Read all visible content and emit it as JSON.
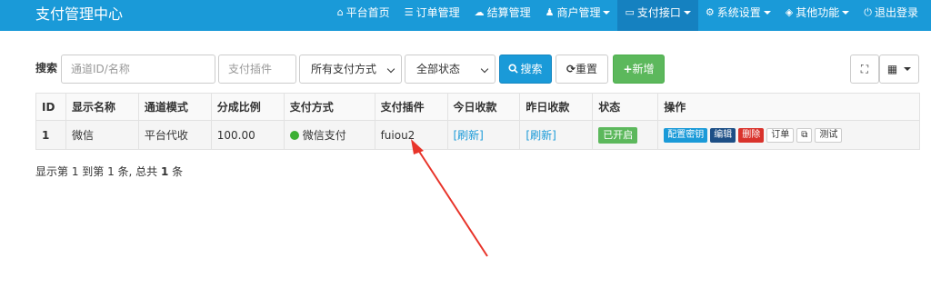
{
  "brand": "支付管理中心",
  "nav": [
    {
      "icon": "home-icon",
      "glyph": "⌂",
      "label": "平台首页"
    },
    {
      "icon": "list-icon",
      "glyph": "☰",
      "label": "订单管理"
    },
    {
      "icon": "cloud-icon",
      "glyph": "☁",
      "label": "结算管理"
    },
    {
      "icon": "user-icon",
      "glyph": "♟",
      "label": "商户管理"
    },
    {
      "icon": "card-icon",
      "glyph": "▭",
      "label": "支付接口"
    },
    {
      "icon": "gear-icon",
      "glyph": "⚙",
      "label": "系统设置"
    },
    {
      "icon": "cube-icon",
      "glyph": "◈",
      "label": "其他功能"
    },
    {
      "icon": "power-icon",
      "glyph": "⏻",
      "label": "退出登录"
    }
  ],
  "toolbar": {
    "search_label": "搜索",
    "channel_placeholder": "通道ID/名称",
    "plugin_placeholder": "支付插件",
    "paytype_select": "所有支付方式",
    "status_select": "全部状态",
    "search_button": "搜索",
    "reset_button": "重置",
    "add_button": "新增",
    "fullscreen_glyph": "⛶",
    "columns_glyph": "▦"
  },
  "table": {
    "headers": [
      "ID",
      "显示名称",
      "通道模式",
      "分成比例",
      "支付方式",
      "支付插件",
      "今日收款",
      "昨日收款",
      "状态",
      "操作"
    ],
    "rows": [
      {
        "id": "1",
        "name": "微信",
        "mode": "平台代收",
        "ratio": "100.00",
        "paytype": "微信支付",
        "plugin": "fuiou2",
        "today": "[刷新]",
        "yesterday": "[刷新]",
        "status": "已开启",
        "ops": {
          "config": "配置密钥",
          "edit": "编辑",
          "delete": "删除",
          "orders": "订单",
          "copy": "⧉",
          "test": "测试"
        }
      }
    ]
  },
  "pagination": {
    "prefix": "显示第 1 到第 1 条, 总共 ",
    "total": "1",
    "suffix": " 条"
  },
  "colors": {
    "navbar": "#1a9ad8",
    "active_nav": "#1581c0",
    "success": "#5cb85c",
    "danger": "#d9332c",
    "annotation_arrow": "#e8342a"
  }
}
